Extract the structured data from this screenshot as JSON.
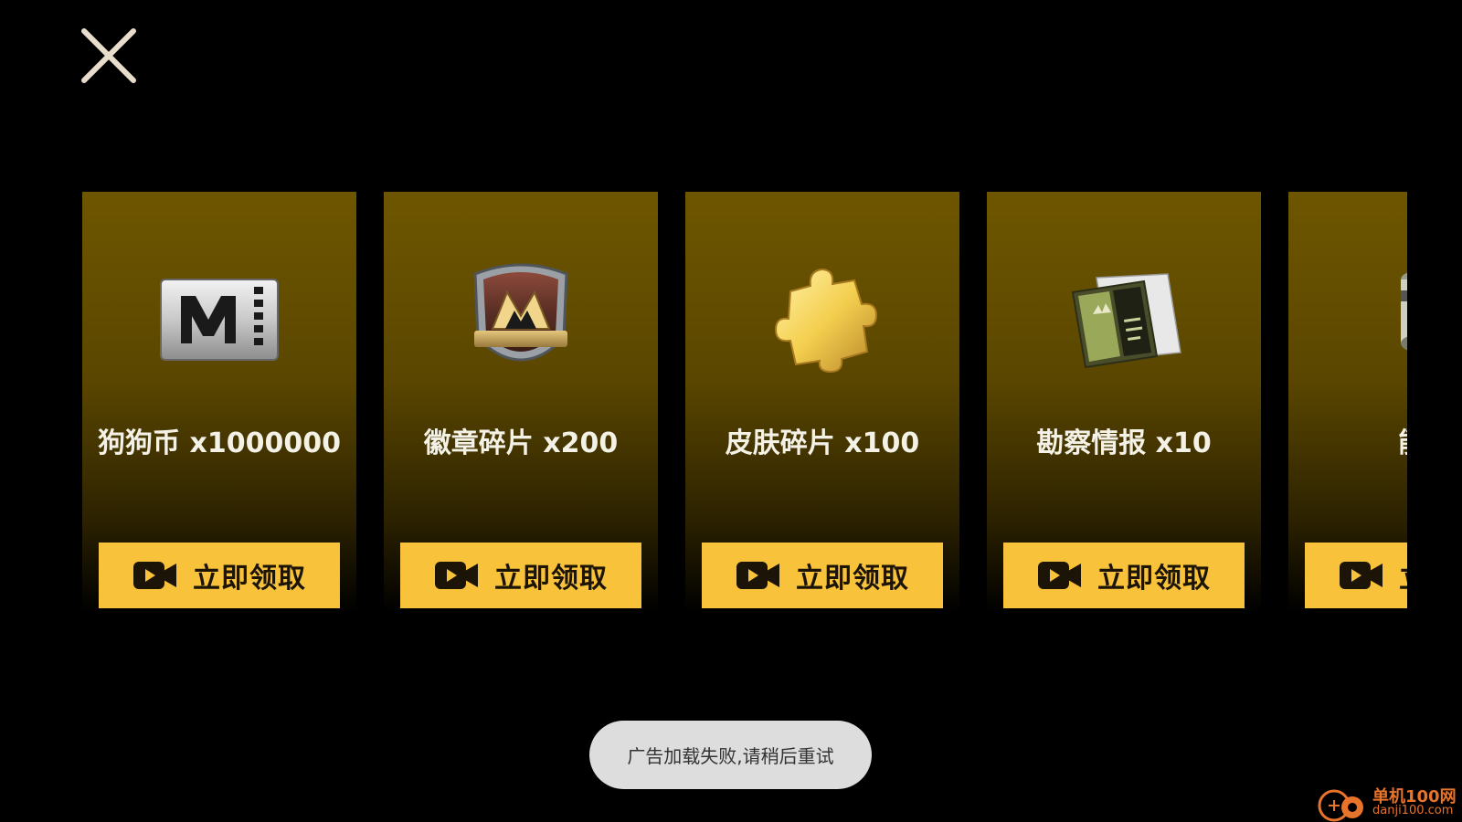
{
  "header": {
    "close_icon": "close-icon"
  },
  "rewards": [
    {
      "title": "狗狗币 x1000000",
      "icon": "m-coin-icon",
      "button_label": "立即领取",
      "button_icon": "video-camera-icon"
    },
    {
      "title": "徽章碎片 x200",
      "icon": "badge-icon",
      "button_label": "立即领取",
      "button_icon": "video-camera-icon"
    },
    {
      "title": "皮肤碎片 x100",
      "icon": "puzzle-piece-icon",
      "button_label": "立即领取",
      "button_icon": "video-camera-icon"
    },
    {
      "title": "勘察情报 x10",
      "icon": "intel-document-icon",
      "button_label": "立即领取",
      "button_icon": "video-camera-icon"
    },
    {
      "title": "能源",
      "icon": "energy-icon",
      "button_label": "立即领取",
      "button_icon": "video-camera-icon"
    }
  ],
  "toast": {
    "message": "广告加载失败,请稍后重试"
  },
  "watermark": {
    "text": "单机100网",
    "domain": "danji100.com"
  },
  "colors": {
    "background": "#000000",
    "card_top": "#6e5600",
    "button": "#f8c33b",
    "button_text": "#1b1407",
    "title_text": "#f4f1e6",
    "toast_bg": "#dddddd",
    "close_icon": "#e8dccb",
    "watermark": "#e8732a"
  }
}
